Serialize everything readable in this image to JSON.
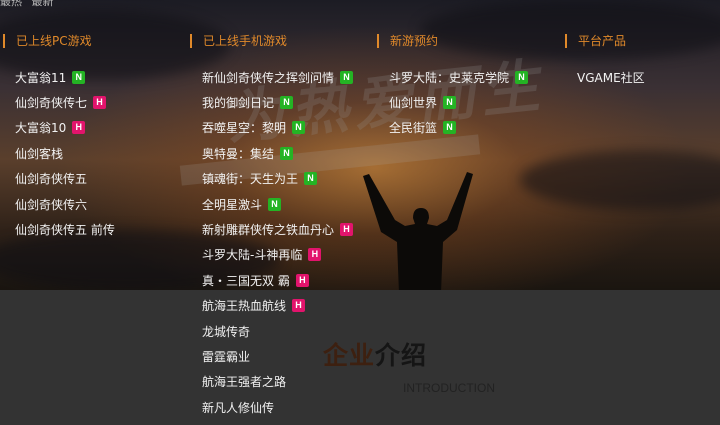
{
  "header_partial": {
    "items": [
      "最热",
      "最新"
    ]
  },
  "hero": {
    "slogan": "为热爱而生"
  },
  "columns": [
    {
      "title": "已上线PC游戏",
      "items": [
        {
          "label": "大富翁11",
          "badge": "N"
        },
        {
          "label": "仙剑奇侠传七",
          "badge": "H"
        },
        {
          "label": "大富翁10",
          "badge": "H"
        },
        {
          "label": "仙剑客栈",
          "badge": ""
        },
        {
          "label": "仙剑奇侠传五",
          "badge": ""
        },
        {
          "label": "仙剑奇侠传六",
          "badge": ""
        },
        {
          "label": "仙剑奇侠传五 前传",
          "badge": ""
        }
      ]
    },
    {
      "title": "已上线手机游戏",
      "items": [
        {
          "label": "新仙剑奇侠传之挥剑问情",
          "badge": "N"
        },
        {
          "label": "我的御剑日记",
          "badge": "N"
        },
        {
          "label": "吞噬星空：黎明",
          "badge": "N"
        },
        {
          "label": "奥特曼：集结",
          "badge": "N"
        },
        {
          "label": "镇魂街：天生为王",
          "badge": "N"
        },
        {
          "label": "全明星激斗",
          "badge": "N"
        },
        {
          "label": "新射雕群侠传之铁血丹心",
          "badge": "H"
        },
        {
          "label": "斗罗大陆-斗神再临",
          "badge": "H"
        },
        {
          "label": "真・三国无双 霸",
          "badge": "H"
        },
        {
          "label": "航海王热血航线",
          "badge": "H"
        },
        {
          "label": "龙城传奇",
          "badge": ""
        },
        {
          "label": "雷霆霸业",
          "badge": ""
        },
        {
          "label": "航海王强者之路",
          "badge": ""
        },
        {
          "label": "新凡人修仙传",
          "badge": ""
        }
      ]
    },
    {
      "title": "新游预约",
      "items": [
        {
          "label": "斗罗大陆：史莱克学院",
          "badge": "N"
        },
        {
          "label": "仙剑世界",
          "badge": "N"
        },
        {
          "label": "全民街篮",
          "badge": "N"
        }
      ]
    },
    {
      "title": "平台产品",
      "items": [
        {
          "label": "VGAME社区",
          "badge": ""
        }
      ]
    }
  ],
  "company": {
    "title_a": "企业",
    "title_b": "介绍",
    "subtitle": "INTRODUCTION"
  },
  "colors": {
    "accent": "#e0892a",
    "badge_new": "#24b324",
    "badge_hot": "#e2146c"
  }
}
